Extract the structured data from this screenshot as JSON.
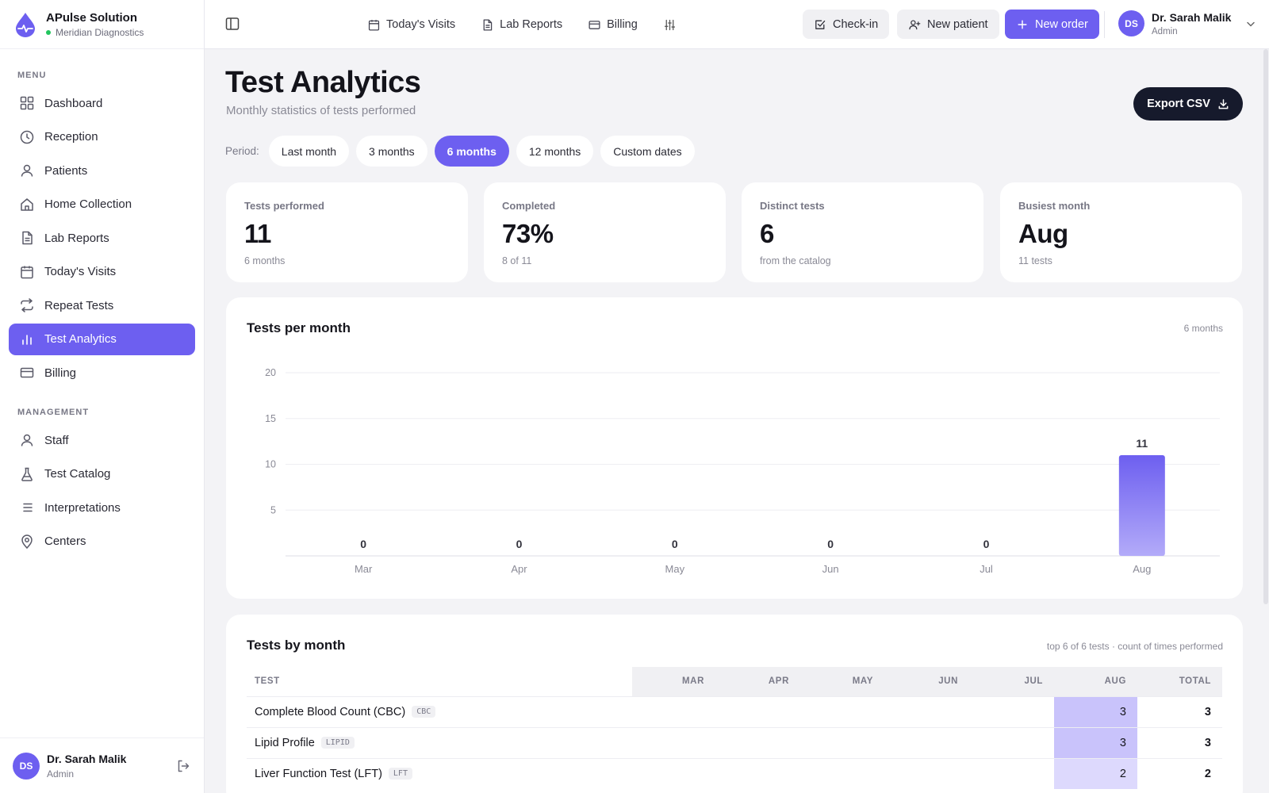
{
  "brand": {
    "name": "APulse Solution",
    "sub": "Meridian Diagnostics"
  },
  "sidebar": {
    "menu_label": "MENU",
    "menu_items": [
      {
        "label": "Dashboard",
        "icon": "grid-icon"
      },
      {
        "label": "Reception",
        "icon": "clock-icon"
      },
      {
        "label": "Patients",
        "icon": "user-icon"
      },
      {
        "label": "Home Collection",
        "icon": "home-icon"
      },
      {
        "label": "Lab Reports",
        "icon": "file-icon"
      },
      {
        "label": "Today's Visits",
        "icon": "calendar-icon"
      },
      {
        "label": "Repeat Tests",
        "icon": "repeat-icon"
      },
      {
        "label": "Test Analytics",
        "icon": "bar-chart-icon",
        "active": true
      },
      {
        "label": "Billing",
        "icon": "card-icon"
      }
    ],
    "management_label": "MANAGEMENT",
    "management_items": [
      {
        "label": "Staff",
        "icon": "user-icon"
      },
      {
        "label": "Test Catalog",
        "icon": "flask-icon"
      },
      {
        "label": "Interpretations",
        "icon": "list-icon"
      },
      {
        "label": "Centers",
        "icon": "map-pin-icon"
      }
    ],
    "footer": {
      "initials": "DS",
      "name": "Dr. Sarah Malik",
      "role": "Admin"
    }
  },
  "topbar": {
    "links": [
      {
        "label": "Today's Visits",
        "icon": "calendar-icon"
      },
      {
        "label": "Lab Reports",
        "icon": "file-icon"
      },
      {
        "label": "Billing",
        "icon": "card-icon"
      }
    ],
    "checkin_label": "Check-in",
    "new_patient_label": "New patient",
    "new_order_label": "New order",
    "user": {
      "initials": "DS",
      "name": "Dr. Sarah Malik",
      "role": "Admin"
    }
  },
  "page": {
    "title": "Test Analytics",
    "subtitle": "Monthly statistics of tests performed",
    "export_label": "Export CSV",
    "period_label": "Period:",
    "periods": [
      "Last month",
      "3 months",
      "6 months",
      "12 months",
      "Custom dates"
    ],
    "active_period": "6 months"
  },
  "stats": [
    {
      "label": "Tests performed",
      "value": "11",
      "note": "6 months"
    },
    {
      "label": "Completed",
      "value": "73%",
      "note": "8 of 11"
    },
    {
      "label": "Distinct tests",
      "value": "6",
      "note": "from the catalog"
    },
    {
      "label": "Busiest month",
      "value": "Aug",
      "note": "11 tests"
    }
  ],
  "chart_card": {
    "title": "Tests per month",
    "note": "6 months"
  },
  "chart_data": {
    "type": "bar",
    "categories": [
      "Mar",
      "Apr",
      "May",
      "Jun",
      "Jul",
      "Aug"
    ],
    "values": [
      0,
      0,
      0,
      0,
      0,
      11
    ],
    "ylim": [
      0,
      20
    ],
    "yticks": [
      5,
      10,
      15,
      20
    ],
    "title": "Tests per month",
    "xlabel": "",
    "ylabel": "",
    "grid": true,
    "bar_color": "#6d5ff0"
  },
  "table_card": {
    "title": "Tests by month",
    "note": "top 6 of 6 tests · count of times performed",
    "headers": [
      "TEST",
      "MAR",
      "APR",
      "MAY",
      "JUN",
      "JUL",
      "AUG",
      "TOTAL"
    ],
    "rows": [
      {
        "test": "Complete Blood Count (CBC)",
        "code": "CBC",
        "months": [
          "",
          "",
          "",
          "",
          "",
          "3"
        ],
        "total": "3"
      },
      {
        "test": "Lipid Profile",
        "code": "LIPID",
        "months": [
          "",
          "",
          "",
          "",
          "",
          "3"
        ],
        "total": "3"
      },
      {
        "test": "Liver Function Test (LFT)",
        "code": "LFT",
        "months": [
          "",
          "",
          "",
          "",
          "",
          "2"
        ],
        "total": "2"
      }
    ]
  },
  "colors": {
    "accent": "#6d5ff0",
    "dark": "#161a2c",
    "background": "#f3f3f6",
    "status_dot": "#22c55e"
  }
}
